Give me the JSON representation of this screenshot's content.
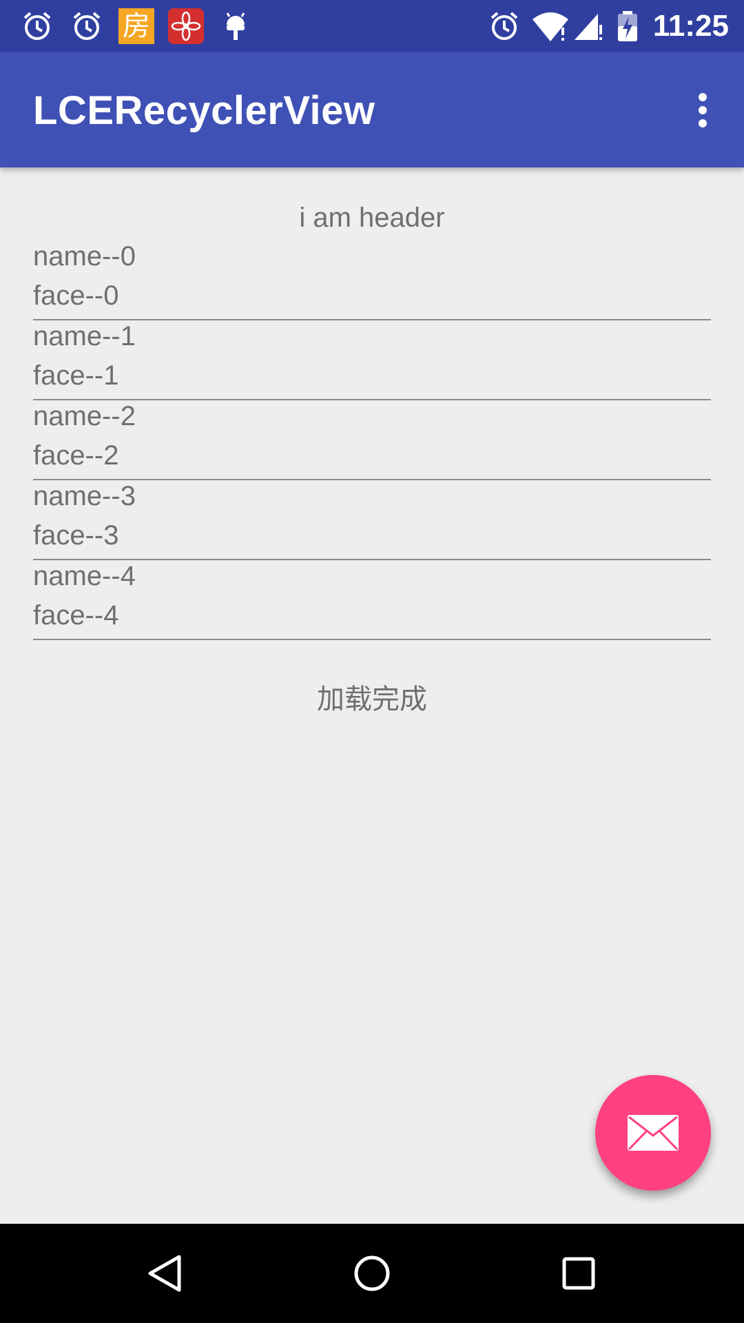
{
  "status_bar": {
    "time": "11:25",
    "left_icons": [
      "alarm-icon",
      "alarm-icon",
      "fang-app-icon",
      "flower-app-icon",
      "android-debug-icon"
    ],
    "right_icons": [
      "alarm-icon",
      "wifi-icon",
      "signal-icon",
      "battery-charging-icon"
    ],
    "fang_char": "房",
    "colors": {
      "background": "#303f9f"
    }
  },
  "app_bar": {
    "title": "LCERecyclerView",
    "menu_icon": "more-vert-icon",
    "colors": {
      "background": "#3f51b5"
    }
  },
  "list": {
    "header": "i am header",
    "items": [
      {
        "name": "name--0",
        "face": "face--0"
      },
      {
        "name": "name--1",
        "face": "face--1"
      },
      {
        "name": "name--2",
        "face": "face--2"
      },
      {
        "name": "name--3",
        "face": "face--3"
      },
      {
        "name": "name--4",
        "face": "face--4"
      }
    ],
    "footer": "加载完成"
  },
  "fab": {
    "icon": "email-icon",
    "color": "#ff4081"
  },
  "nav_bar": {
    "buttons": [
      "back-icon",
      "home-icon",
      "recents-icon"
    ]
  }
}
